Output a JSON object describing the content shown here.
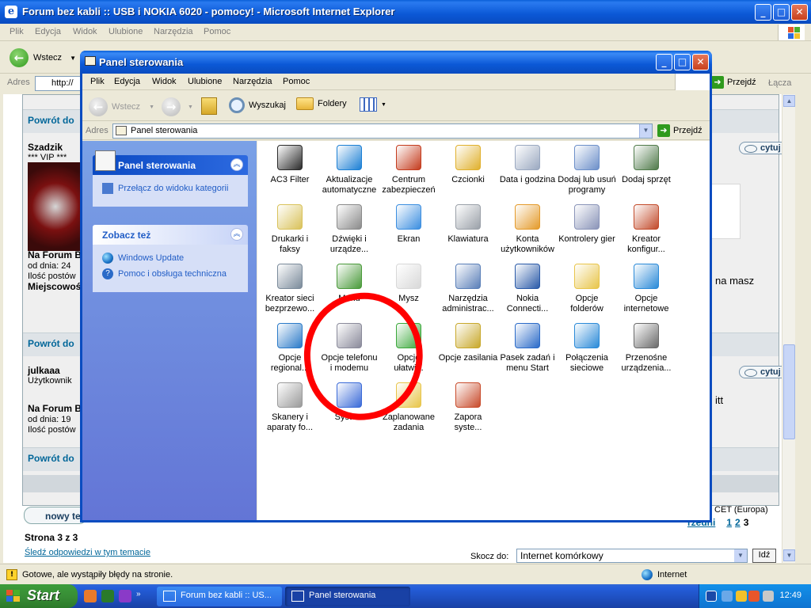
{
  "ie": {
    "title": "Forum bez kabli :: USB i NOKIA 6020 - pomocy! - Microsoft Internet Explorer",
    "menu": [
      "Plik",
      "Edycja",
      "Widok",
      "Ulubione",
      "Narzędzia",
      "Pomoc"
    ],
    "back_label": "Wstecz",
    "address_label": "Adres",
    "address_value": "http://",
    "go_label": "Przejdź",
    "links_label": "Łącza",
    "status_text": "Gotowe, ale wystąpiły błędy na stronie.",
    "zone": "Internet"
  },
  "forum": {
    "back_link": "Powrót do",
    "user1": {
      "name": "Szadzik",
      "rank": "*** VIP ***",
      "line1": "Na Forum B",
      "line2": "od dnia: 24",
      "line3": "Ilość postów",
      "line4": "Miejscowość"
    },
    "user2": {
      "name": "julkaaa",
      "rank": "Użytkownik",
      "line1": "Na Forum B",
      "line2": "od dnia: 19",
      "line3": "Ilość postów"
    },
    "cytuj": "cytuj",
    "snippet1": "na masz",
    "snippet2": "itt",
    "timezone": "CET (Europa)",
    "pages": [
      "1",
      "2",
      "3"
    ],
    "page_prev": "rzedni",
    "new_topic": "nowy te",
    "page_info": "Strona 3 z 3",
    "watch": "Śledź odpowiedzi w tym temacie",
    "jump_label": "Skocz do:",
    "jump_value": "Internet komórkowy",
    "jump_btn": "Idź"
  },
  "cp": {
    "title": "Panel sterowania",
    "menu": [
      "Plik",
      "Edycja",
      "Widok",
      "Ulubione",
      "Narzędzia",
      "Pomoc"
    ],
    "back": "Wstecz",
    "search": "Wyszukaj",
    "folders": "Foldery",
    "address_label": "Adres",
    "address_value": "Panel sterowania",
    "go": "Przejdź",
    "task1_title": "Panel sterowania",
    "task1_link": "Przełącz do widoku kategorii",
    "task2_title": "Zobacz też",
    "task2_links": [
      "Windows Update",
      "Pomoc i obsługa techniczna"
    ],
    "icons": [
      {
        "l1": "AC3 Filter",
        "l2": "",
        "color": "#2a2a2a"
      },
      {
        "l1": "Aktualizacje",
        "l2": "automatyczne",
        "color": "#1b7fd4"
      },
      {
        "l1": "Centrum",
        "l2": "zabezpieczeń",
        "color": "#c43b1d"
      },
      {
        "l1": "Czcionki",
        "l2": "",
        "color": "#e0b02c"
      },
      {
        "l1": "Data i godzina",
        "l2": "",
        "color": "#9aa8c0"
      },
      {
        "l1": "Dodaj lub usuń",
        "l2": "programy",
        "color": "#6c8fc9"
      },
      {
        "l1": "Dodaj sprzęt",
        "l2": "",
        "color": "#4f7a4a"
      },
      {
        "l1": "Drukarki i",
        "l2": "faksy",
        "color": "#d9c25a"
      },
      {
        "l1": "Dźwięki i",
        "l2": "urządze...",
        "color": "#8a8a8a"
      },
      {
        "l1": "Ekran",
        "l2": "",
        "color": "#3b8ee0"
      },
      {
        "l1": "Klawiatura",
        "l2": "",
        "color": "#9aa0a8"
      },
      {
        "l1": "Konta",
        "l2": "użytkowników",
        "color": "#e49a2a"
      },
      {
        "l1": "Kontrolery gier",
        "l2": "",
        "color": "#8a94b8"
      },
      {
        "l1": "Kreator",
        "l2": "konfigur...",
        "color": "#c24a2a"
      },
      {
        "l1": "Kreator sieci",
        "l2": "bezprzewo...",
        "color": "#7a8a9a"
      },
      {
        "l1": "Menu",
        "l2": "",
        "color": "#4a9a3a"
      },
      {
        "l1": "Mysz",
        "l2": "",
        "color": "#d8d8d8"
      },
      {
        "l1": "Narzędzia",
        "l2": "administrac...",
        "color": "#5a7fb8"
      },
      {
        "l1": "Nokia",
        "l2": "Connecti...",
        "color": "#2a5aa8"
      },
      {
        "l1": "Opcje",
        "l2": "folderów",
        "color": "#e8c54a"
      },
      {
        "l1": "Opcje",
        "l2": "internetowe",
        "color": "#2a8ad8"
      },
      {
        "l1": "Opcje",
        "l2": "regional...",
        "color": "#2a7ac8"
      },
      {
        "l1": "Opcje telefonu",
        "l2": "i modemu",
        "color": "#8a8a9a"
      },
      {
        "l1": "Opcje",
        "l2": "ułatwi...",
        "color": "#3aa83a"
      },
      {
        "l1": "Opcje zasilania",
        "l2": "",
        "color": "#c8a82a"
      },
      {
        "l1": "Pasek zadań i",
        "l2": "menu Start",
        "color": "#2a6ac8"
      },
      {
        "l1": "Połączenia",
        "l2": "sieciowe",
        "color": "#2a8ad8"
      },
      {
        "l1": "Przenośne",
        "l2": "urządzenia...",
        "color": "#6a6a6a"
      },
      {
        "l1": "Skanery i",
        "l2": "aparaty fo...",
        "color": "#9a9a9a"
      },
      {
        "l1": "System",
        "l2": "",
        "color": "#3a6ad8"
      },
      {
        "l1": "Zaplanowane",
        "l2": "zadania",
        "color": "#e8c54a"
      },
      {
        "l1": "Zapora",
        "l2": "syste...",
        "color": "#c84a2a"
      }
    ]
  },
  "taskbar": {
    "start": "Start",
    "task1": "Forum bez kabli :: US...",
    "task2": "Panel sterowania",
    "time": "12:49"
  }
}
